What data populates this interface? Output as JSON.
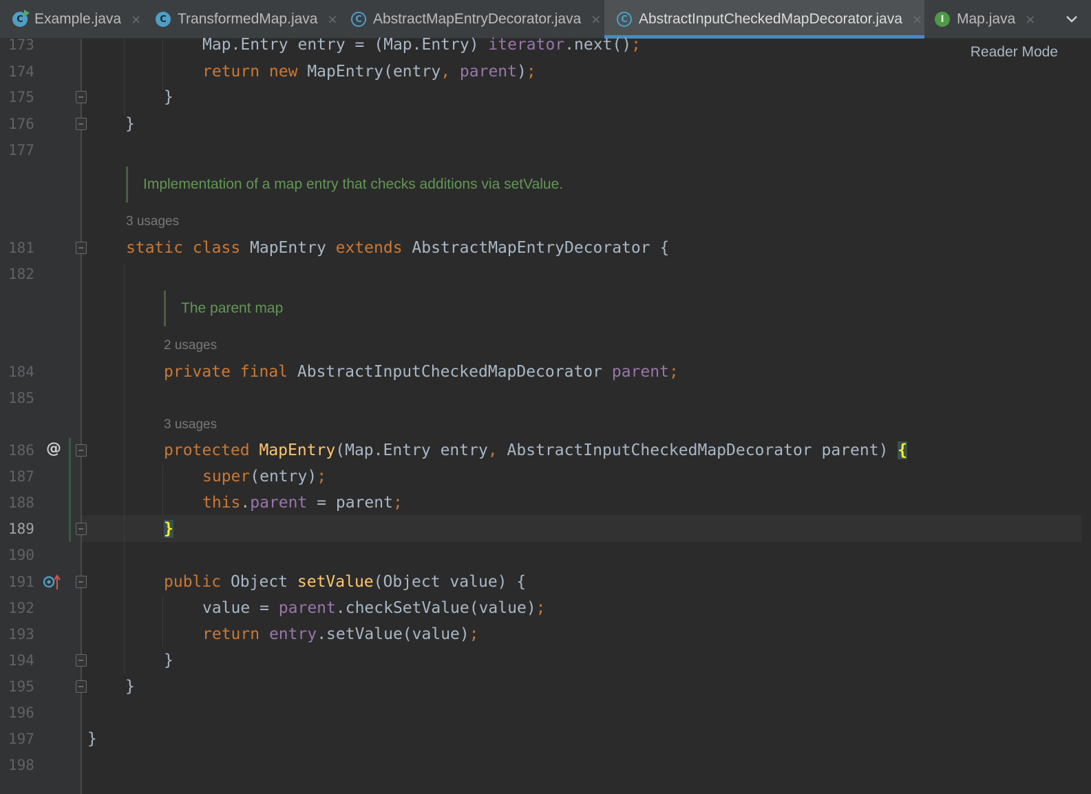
{
  "tabs": [
    {
      "label": "Example.java",
      "icon": "class-runnable-icon",
      "close": "×"
    },
    {
      "label": "TransformedMap.java",
      "icon": "class-icon",
      "close": "×"
    },
    {
      "label": "AbstractMapEntryDecorator.java",
      "icon": "abstract-class-icon",
      "close": "×"
    },
    {
      "label": "AbstractInputCheckedMapDecorator.java",
      "icon": "abstract-class-icon",
      "close": "×",
      "active": true
    },
    {
      "label": "Map.java",
      "icon": "interface-icon",
      "close": "×"
    }
  ],
  "tab_icon_letters": {
    "class": "C",
    "interface": "I"
  },
  "editor": {
    "reader_mode": "Reader Mode",
    "current_line": "189",
    "line_numbers": [
      "173",
      "174",
      "175",
      "176",
      "177",
      "181",
      "182",
      "184",
      "185",
      "186",
      "187",
      "188",
      "189",
      "190",
      "191",
      "192",
      "193",
      "194",
      "195",
      "196",
      "197",
      "198"
    ],
    "docs": {
      "mapentry": "Implementation of a map entry that checks additions via setValue.",
      "parent": "The parent map"
    },
    "usages": {
      "class": "3 usages",
      "field": "2 usages",
      "ctor": "3 usages"
    },
    "gutter_marks": {
      "annotation": "@"
    }
  },
  "colors": {
    "background": "#2b2b2b",
    "keyword": "#cc7832",
    "field": "#9876aa",
    "method": "#ffc66d",
    "doc_comment": "#629755",
    "active_tab_underline": "#4a88c7"
  }
}
